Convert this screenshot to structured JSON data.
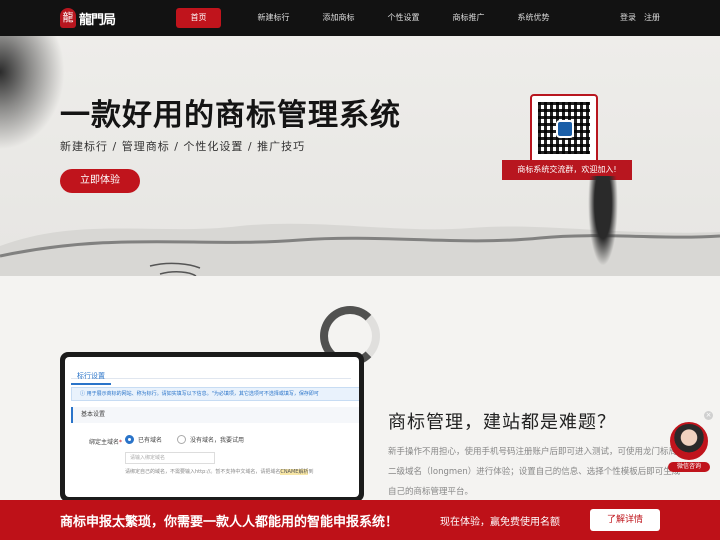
{
  "header": {
    "logo_mark": "龍",
    "logo_text": "龍門局",
    "nav": [
      "首页",
      "新建标行",
      "添加商标",
      "个性设置",
      "商标推广",
      "系统优势"
    ],
    "login": "登录",
    "register": "注册"
  },
  "hero": {
    "title": "一款好用的商标管理系统",
    "subtitle": "新建标行 / 管理商标 / 个性化设置 / 推广技巧",
    "cta": "立即体验",
    "qr_banner": "商标系统交流群，欢迎加入!"
  },
  "mockup": {
    "tab": "标行设置",
    "notice": "用于展示商标的网站、称为标行。请如实填写以下信息。\"为必填项，其它选项可不选择或填写，保存即可",
    "section": "基本设置",
    "field_label": "绑定主域名",
    "field_required": "*",
    "radio_1": "已有域名",
    "radio_2": "没有域名，我要试用",
    "input_placeholder": "请输入绑定域名",
    "hint_before": "请绑定自己的域名，不需要输入http://。暂不支持中文域名，请把域名",
    "hint_highlight": "CNAME解析",
    "hint_after": "到"
  },
  "feature": {
    "title": "商标管理，建站都是难题？",
    "text": "新手操作不用担心，使用手机号码注册账户后即可进入测试，可使用龙门标局的二级域名（longmen）进行体验；设置自己的信息、选择个性模板后即可生成自己的商标管理平台。"
  },
  "consult": {
    "close": "×",
    "label": "微信咨询"
  },
  "banner": {
    "main": "商标申报太繁琐，你需要一款人人都能用的智能申报系统！",
    "sub": "现在体验，赢免费使用名额",
    "button": "了解详情"
  }
}
